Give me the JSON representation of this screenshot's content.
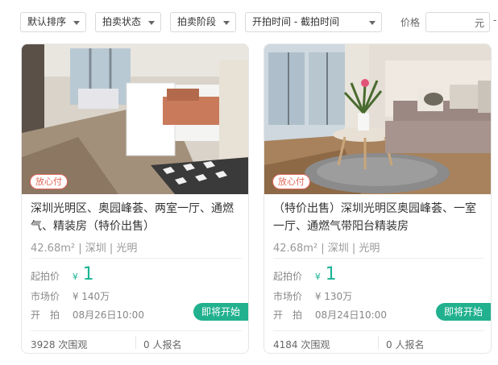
{
  "filters": {
    "sort": "默认排序",
    "auction_status": "拍卖状态",
    "auction_stage": "拍卖阶段",
    "time_range": "开拍时间 - 截拍时间",
    "price_label": "价格",
    "price_unit": "元",
    "price_dash": "-"
  },
  "listings": [
    {
      "badge": "放心付",
      "title": "深圳光明区、奥园峰荟、两室一厅、通燃气、精装房（特价出售）",
      "area": "42.68m²",
      "city": "深圳",
      "district": "光明",
      "start_price_label": "起拍价",
      "start_price_currency": "¥",
      "start_price_value": "1",
      "market_price_label": "市场价",
      "market_price_value": "¥ 140万",
      "open_label": "开　拍",
      "open_time": "08月26日10:00",
      "status": "即将开始",
      "views": "3928 次围观",
      "signups": "0 人报名"
    },
    {
      "badge": "放心付",
      "title": "（特价出售）深圳光明区奥园峰荟、一室一厅、通燃气带阳台精装房",
      "area": "42.68m²",
      "city": "深圳",
      "district": "光明",
      "start_price_label": "起拍价",
      "start_price_currency": "¥",
      "start_price_value": "1",
      "market_price_label": "市场价",
      "market_price_value": "¥ 130万",
      "open_label": "开　拍",
      "open_time": "08月24日10:00",
      "status": "即将开始",
      "views": "4184 次围观",
      "signups": "0 人报名"
    }
  ]
}
